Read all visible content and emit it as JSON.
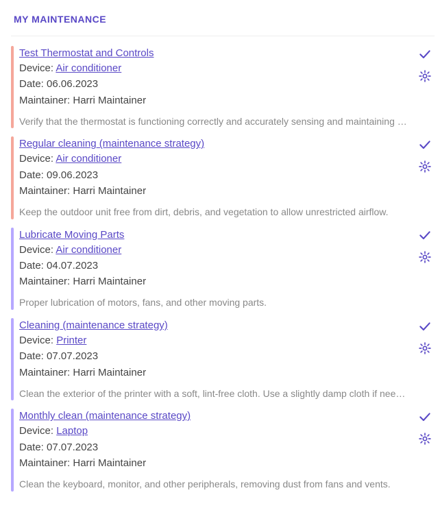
{
  "page_title": "MY MAINTENANCE",
  "labels": {
    "device": "Device: ",
    "date": "Date: ",
    "maintainer": "Maintainer: "
  },
  "colors": {
    "accent": "#5948c6",
    "overdue": "#f5a79a",
    "due": "#b6a8ff"
  },
  "items": [
    {
      "title": "Test Thermostat and Controls",
      "device": "Air conditioner",
      "date": "06.06.2023",
      "maintainer": "Harri Maintainer",
      "description": "Verify that the thermostat is functioning correctly and accurately sensing and maintaining temperature.",
      "status_color": "overdue"
    },
    {
      "title": "Regular cleaning (maintenance strategy)",
      "device": "Air conditioner",
      "date": "09.06.2023",
      "maintainer": "Harri Maintainer",
      "description": "Keep the outdoor unit free from dirt, debris, and vegetation to allow unrestricted airflow.",
      "status_color": "overdue"
    },
    {
      "title": "Lubricate Moving Parts",
      "device": "Air conditioner",
      "date": "04.07.2023",
      "maintainer": "Harri Maintainer",
      "description": "Proper lubrication of motors, fans, and other moving parts.",
      "status_color": "due"
    },
    {
      "title": "Cleaning (maintenance strategy)",
      "device": "Printer",
      "date": "07.07.2023",
      "maintainer": "Harri Maintainer",
      "description": "Clean the exterior of the printer with a soft, lint-free cloth. Use a slightly damp cloth if needed.",
      "status_color": "due"
    },
    {
      "title": "Monthly clean (maintenance strategy)",
      "device": "Laptop",
      "date": "07.07.2023",
      "maintainer": "Harri Maintainer",
      "description": "Clean the keyboard, monitor, and other peripherals, removing dust from fans and vents.",
      "status_color": "due"
    }
  ]
}
